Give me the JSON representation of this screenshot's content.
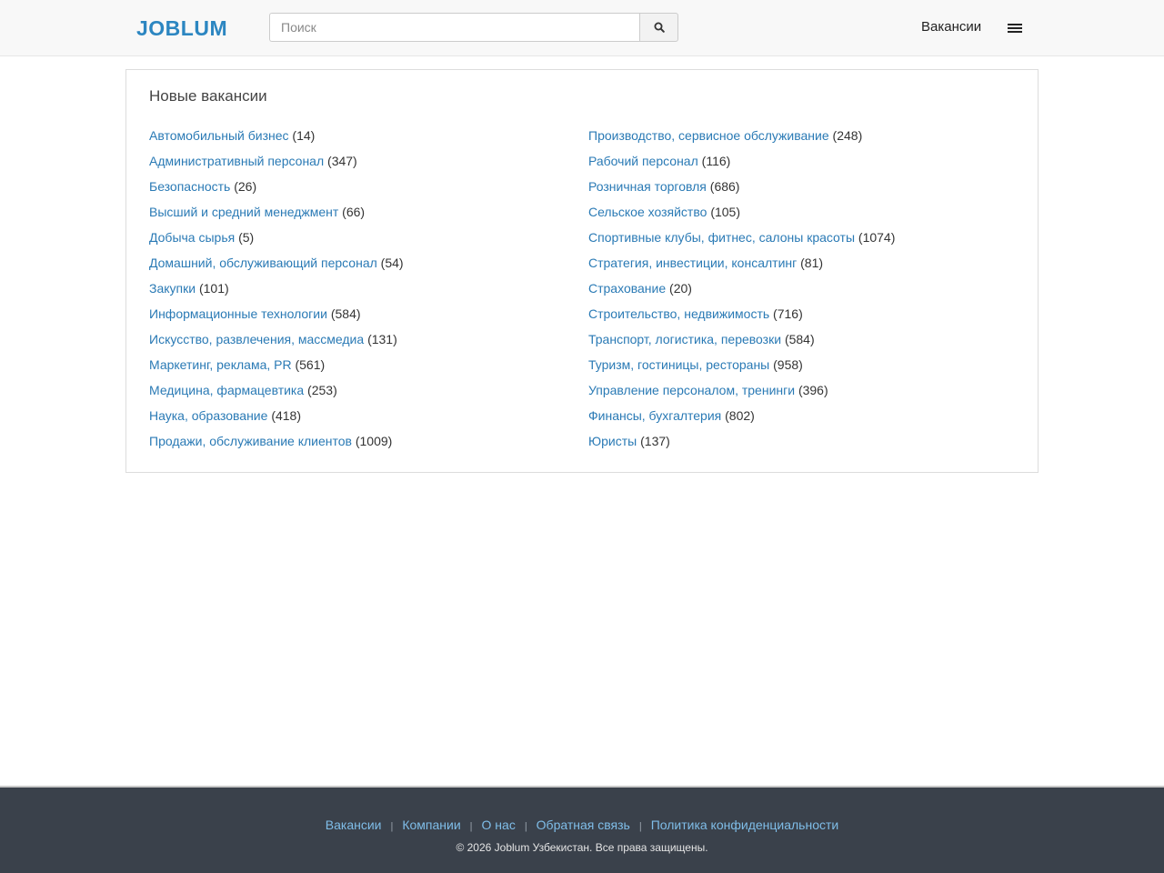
{
  "header": {
    "logo": "JOBLUM",
    "search_placeholder": "Поиск",
    "nav_vacancies": "Вакансии"
  },
  "panel": {
    "title": "Новые вакансии",
    "left": [
      {
        "label": "Автомобильный бизнес",
        "count": "(14)"
      },
      {
        "label": "Административный персонал",
        "count": "(347)"
      },
      {
        "label": "Безопасность",
        "count": "(26)"
      },
      {
        "label": "Высший и средний менеджмент",
        "count": "(66)"
      },
      {
        "label": "Добыча сырья",
        "count": "(5)"
      },
      {
        "label": "Домашний, обслуживающий персонал",
        "count": "(54)"
      },
      {
        "label": "Закупки",
        "count": "(101)"
      },
      {
        "label": "Информационные технологии",
        "count": "(584)"
      },
      {
        "label": "Искусство, развлечения, массмедиа",
        "count": "(131)"
      },
      {
        "label": "Маркетинг, реклама, PR",
        "count": "(561)"
      },
      {
        "label": "Медицина, фармацевтика",
        "count": "(253)"
      },
      {
        "label": "Наука, образование",
        "count": "(418)"
      },
      {
        "label": "Продажи, обслуживание клиентов",
        "count": "(1009)"
      }
    ],
    "right": [
      {
        "label": "Производство, сервисное обслуживание",
        "count": "(248)"
      },
      {
        "label": "Рабочий персонал",
        "count": "(116)"
      },
      {
        "label": "Розничная торговля",
        "count": "(686)"
      },
      {
        "label": "Сельское хозяйство",
        "count": "(105)"
      },
      {
        "label": "Спортивные клубы, фитнес, салоны красоты",
        "count": "(1074)"
      },
      {
        "label": "Стратегия, инвестиции, консалтинг",
        "count": "(81)"
      },
      {
        "label": "Страхование",
        "count": "(20)"
      },
      {
        "label": "Строительство, недвижимость",
        "count": "(716)"
      },
      {
        "label": "Транспорт, логистика, перевозки",
        "count": "(584)"
      },
      {
        "label": "Туризм, гостиницы, рестораны",
        "count": "(958)"
      },
      {
        "label": "Управление персоналом, тренинги",
        "count": "(396)"
      },
      {
        "label": "Финансы, бухгалтерия",
        "count": "(802)"
      },
      {
        "label": "Юристы",
        "count": "(137)"
      }
    ]
  },
  "footer": {
    "links": [
      "Вакансии",
      "Компании",
      "О нас",
      "Обратная связь",
      "Политика конфиденциальности"
    ],
    "separator": "|",
    "copyright": "© 2026 Joblum Узбекистан. Все права защищены."
  },
  "icons": {
    "search": "search-icon",
    "menu": "menu-icon"
  },
  "colors": {
    "brand": "#2c86c1",
    "link": "#2a7ab5",
    "footer_bg": "#3a414b",
    "footer_link": "#7fbde8"
  }
}
